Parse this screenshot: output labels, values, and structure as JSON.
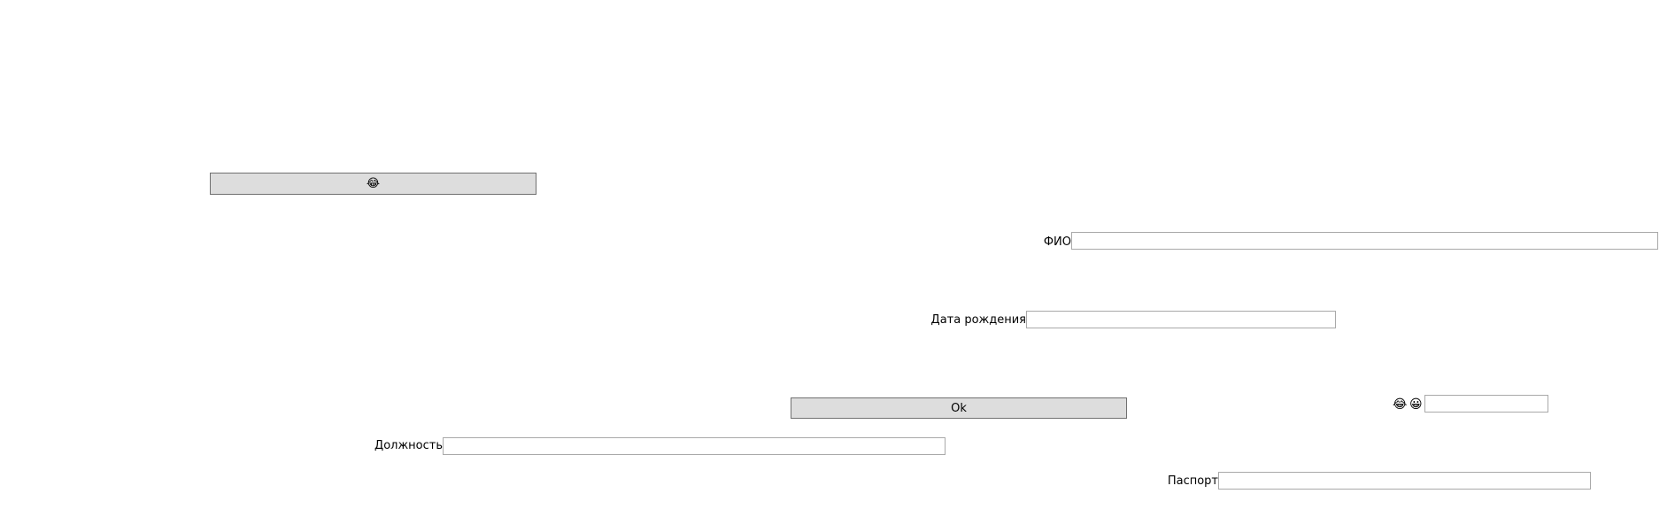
{
  "buttons": {
    "emoji_button_label": "😂",
    "ok_label": "Ok"
  },
  "fields": {
    "fio": {
      "label": "ФИО",
      "value": ""
    },
    "birth_date": {
      "label": "Дата рождения",
      "value": ""
    },
    "emoji_field": {
      "label_a": "😂",
      "label_b": "😀",
      "value": ""
    },
    "position": {
      "label": "Должность",
      "value": ""
    },
    "passport": {
      "label": "Паспорт",
      "value": ""
    }
  }
}
